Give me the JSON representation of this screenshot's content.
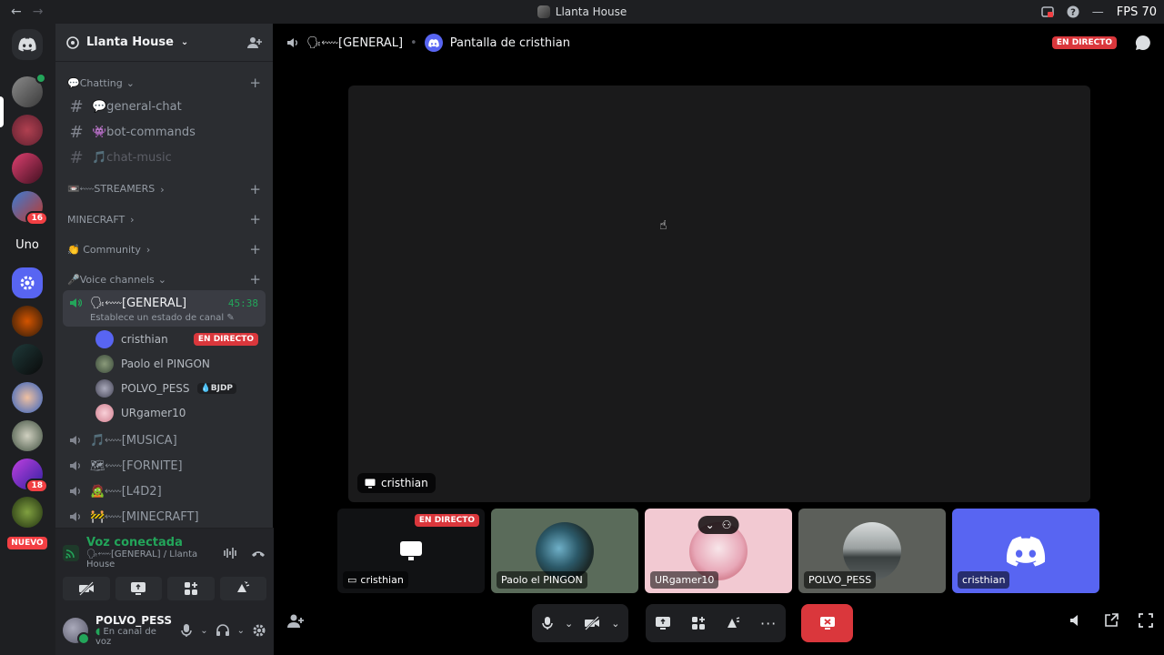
{
  "titlebar": {
    "title": "Llanta House",
    "back": "←",
    "forward": "→",
    "fps": "FPS 70",
    "minimize": "—"
  },
  "guilds": {
    "badges": [
      "16",
      "18"
    ],
    "uno_label": "Uno",
    "nuevo_label": "NUEVO"
  },
  "server": {
    "name": "Llanta House"
  },
  "categories": {
    "chatting": "💬Chatting",
    "streamers": "📼⬳STREAMERS",
    "minecraft": "MINECRAFT",
    "community": "👏 Community",
    "voice": "🎤Voice channels"
  },
  "text_channels": [
    {
      "name": "💬general-chat"
    },
    {
      "name": "👾bot-commands"
    },
    {
      "name": "🎵chat-music"
    }
  ],
  "active_voice": {
    "name": "🗣⬳[GENERAL]",
    "timer": "45:38",
    "status": "Establece un estado de canal"
  },
  "members": [
    {
      "name": "cristhian",
      "badge": "EN DIRECTO"
    },
    {
      "name": "Paolo el PINGON"
    },
    {
      "name": "POLVO_PESS",
      "badge": "💧BJDP"
    },
    {
      "name": "URgamer10"
    }
  ],
  "voice_channels": [
    {
      "name": "🎵⬳[MUSICA]"
    },
    {
      "name": "🗺⬳[FORNITE]"
    },
    {
      "name": "🧟⬳[L4D2]"
    },
    {
      "name": "🚧⬳[MINECRAFT]"
    }
  ],
  "voice_panel": {
    "title": "Voz conectada",
    "subtitle": "🗣⬳[GENERAL] / Llanta House"
  },
  "user": {
    "name": "POLVO_PESS",
    "status": "En canal de voz"
  },
  "stage": {
    "channel": "🗣⬳[GENERAL]",
    "sep": "•",
    "stream_title": "Pantalla de cristhian",
    "live_label": "EN DIRECTO",
    "screen_owner": "cristhian"
  },
  "tiles": [
    {
      "name": "cristhian",
      "live": "EN DIRECTO"
    },
    {
      "name": "Paolo el PINGON"
    },
    {
      "name": "URgamer10"
    },
    {
      "name": "POLVO_PESS"
    },
    {
      "name": "cristhian"
    }
  ],
  "colors": {
    "accent": "#5865f2",
    "danger": "#da373c",
    "online": "#23a55a"
  }
}
